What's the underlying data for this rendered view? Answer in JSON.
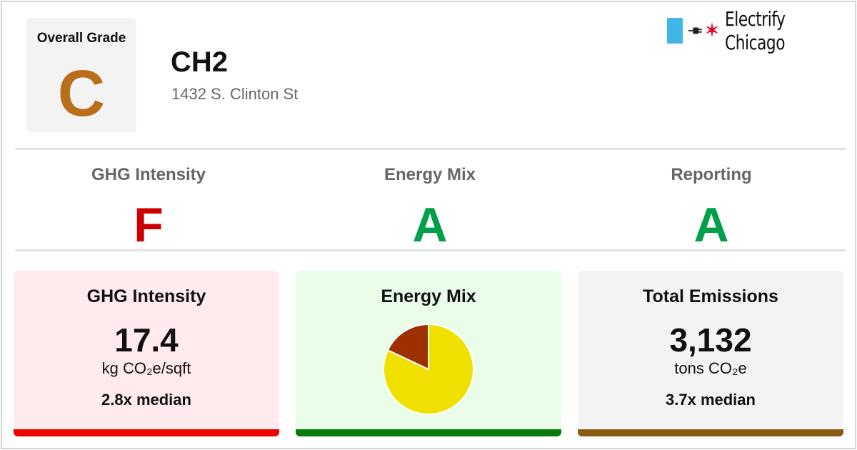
{
  "overall": {
    "label": "Overall Grade",
    "grade": "C",
    "color": "#b86e1a"
  },
  "building": {
    "name": "CH2",
    "address": "1432 S. Clinton St"
  },
  "brand": {
    "name": "Electrify Chicago",
    "flag_color": "#41b6e6",
    "star_color": "#e4002b",
    "icons": [
      "plug-icon",
      "star-icon"
    ]
  },
  "subgrades": [
    {
      "label": "GHG Intensity",
      "grade": "F",
      "color": "#cc0000"
    },
    {
      "label": "Energy Mix",
      "grade": "A",
      "color": "#00a04a"
    },
    {
      "label": "Reporting",
      "grade": "A",
      "color": "#00a04a"
    }
  ],
  "cards": {
    "ghg": {
      "title": "GHG Intensity",
      "value": "17.4",
      "unit": "kg CO₂e/sqft",
      "median": "2.8x median",
      "bg": "#ffebee",
      "bar": "#ee0000"
    },
    "mix": {
      "title": "Energy Mix",
      "bg": "#e9fde9",
      "bar": "#0a7a0a"
    },
    "emissions": {
      "title": "Total Emissions",
      "value": "3,132",
      "unit": "tons CO₂e",
      "median": "3.7x median",
      "bg": "#f3f3f3",
      "bar": "#8a5a10"
    }
  },
  "chart_data": {
    "type": "pie",
    "slices": [
      {
        "value": 82,
        "color": "#f0e000"
      },
      {
        "value": 18,
        "color": "#9c3000"
      }
    ]
  }
}
